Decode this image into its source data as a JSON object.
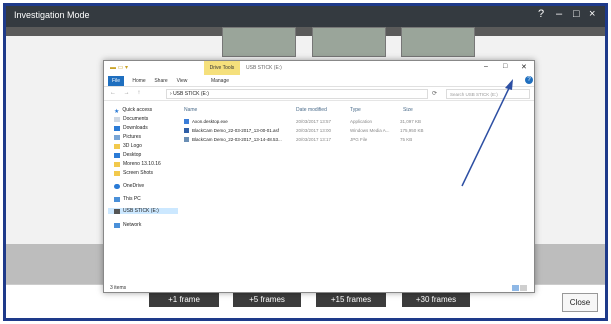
{
  "app": {
    "title": "Investigation Mode",
    "controls": {
      "help": "?",
      "minimize": "–",
      "maximize": "□",
      "close": "×"
    }
  },
  "bottom": {
    "frame_buttons": [
      "+1 frame",
      "+5 frames",
      "+15 frames",
      "+30 frames"
    ],
    "close_label": "Close"
  },
  "explorer": {
    "window_title": "USB STICK (E:)",
    "context_tab": "Drive Tools",
    "ribbon_tabs": [
      "File",
      "Home",
      "Share",
      "View",
      "Manage"
    ],
    "controls": {
      "minimize": "–",
      "maximize": "□",
      "close": "✕"
    },
    "address": "USB STICK (E:)",
    "address_prefix": "›",
    "search_placeholder": "Search USB STICK (E:)",
    "nav": {
      "quick_access": "Quick access",
      "items": [
        "Documents",
        "Downloads",
        "Pictures",
        "3D Logo",
        "Desktop",
        "Moreno 13.10.16",
        "Screen Shots"
      ],
      "onedrive": "OneDrive",
      "thispc": "This PC",
      "usb": "USB STICK (E:)",
      "network": "Network"
    },
    "columns": {
      "name": "Name",
      "date": "Date modified",
      "type": "Type",
      "size": "Size"
    },
    "files": [
      {
        "name": "Axon.desktop.exe",
        "date": "20/03/2017 13:57",
        "type": "Application",
        "size": "31,097 KB"
      },
      {
        "name": "BlackCam Demo_22-03-2017_13-00-01.asf",
        "date": "20/03/2017 13:00",
        "type": "Windows Media A...",
        "size": "175,950 KB"
      },
      {
        "name": "BlackCam Demo_22-03-2017_13-14-48.53...",
        "date": "20/03/2017 13:17",
        "type": "JPG File",
        "size": "75 KB"
      }
    ],
    "status": "3 items"
  },
  "colors": {
    "accent": "#1e3a8a",
    "titlebar": "#343a40",
    "arrow": "#2d4fa3"
  }
}
